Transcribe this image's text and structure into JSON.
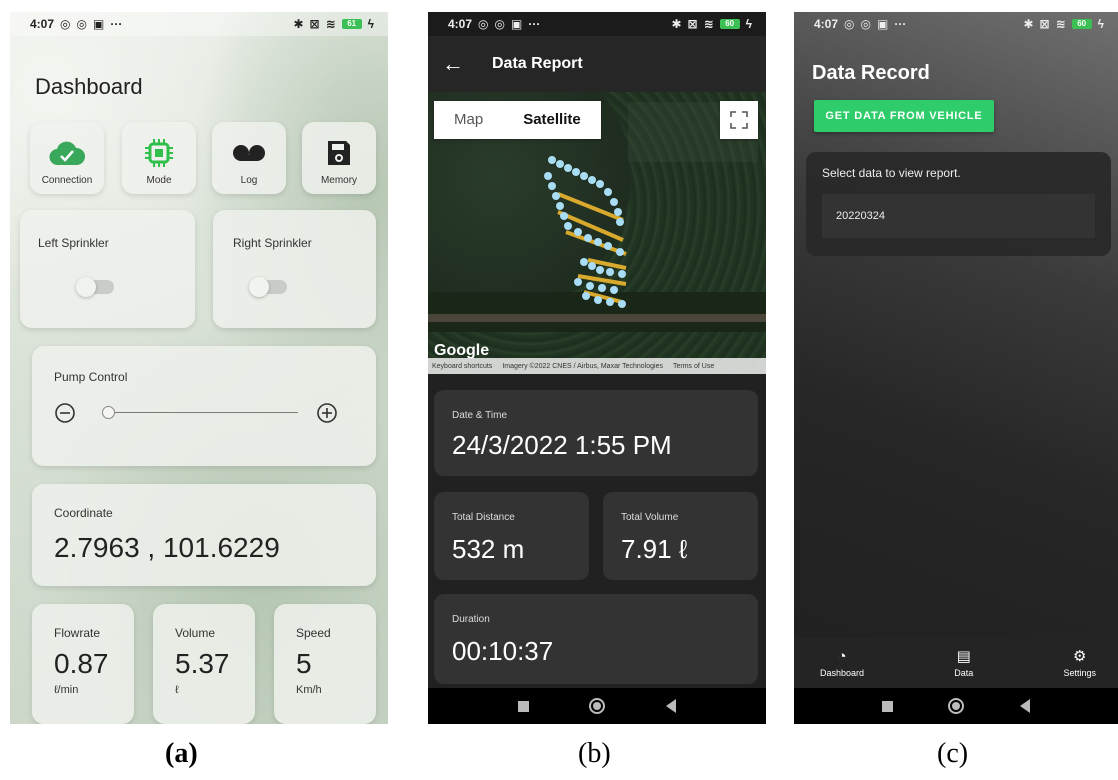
{
  "status_bar": {
    "time": "4:07",
    "dots": "···",
    "battery_a": "61",
    "battery_b": "60",
    "battery_c": "60"
  },
  "captions": {
    "a": "(a)",
    "b": "(b)",
    "c": "(c)"
  },
  "dashboard": {
    "title": "Dashboard",
    "tiles": [
      {
        "label": "Connection",
        "icon": "cloud-check-icon",
        "color": "#3aa85a"
      },
      {
        "label": "Mode",
        "icon": "chip-icon",
        "color": "#2fbf4a"
      },
      {
        "label": "Log",
        "icon": "cassette-icon",
        "color": "#222222"
      },
      {
        "label": "Memory",
        "icon": "floppy-icon",
        "color": "#222222"
      }
    ],
    "left_sprinkler": {
      "label": "Left Sprinkler",
      "on": false
    },
    "right_sprinkler": {
      "label": "Right Sprinkler",
      "on": false
    },
    "pump": {
      "label": "Pump Control",
      "level": 0
    },
    "coordinate": {
      "label": "Coordinate",
      "value": "2.7963 , 101.6229"
    },
    "flowrate": {
      "label": "Flowrate",
      "value": "0.87",
      "unit": "ℓ/min"
    },
    "volume": {
      "label": "Volume",
      "value": "5.37",
      "unit": "ℓ"
    },
    "speed": {
      "label": "Speed",
      "value": "5",
      "unit": "Km/h"
    }
  },
  "report": {
    "back_icon": "arrow-left-icon",
    "title": "Data Report",
    "map_tabs": [
      "Map",
      "Satellite"
    ],
    "selected_map_tab": "Satellite",
    "google_logo": "Google",
    "attribution": [
      "Keyboard shortcuts",
      "Imagery ©2022 CNES / Airbus, Maxar Technologies",
      "Terms of Use"
    ],
    "date_time": {
      "label": "Date & Time",
      "value": "24/3/2022 1:55 PM"
    },
    "total_distance": {
      "label": "Total Distance",
      "value": "532 m"
    },
    "total_volume": {
      "label": "Total Volume",
      "value": "7.91 ℓ"
    },
    "duration": {
      "label": "Duration",
      "value": "00:10:37"
    },
    "route_color": "#d8a92c",
    "marker_color": "#a9dcf5"
  },
  "record": {
    "title": "Data Record",
    "button": "GET DATA FROM VEHICLE",
    "button_color": "#2ecc6a",
    "prompt": "Select data to view report.",
    "items": [
      "20220324"
    ],
    "bottom_nav": [
      {
        "label": "Dashboard",
        "icon": "speedometer-icon"
      },
      {
        "label": "Data",
        "icon": "document-icon"
      },
      {
        "label": "Settings",
        "icon": "gear-icon"
      }
    ]
  }
}
